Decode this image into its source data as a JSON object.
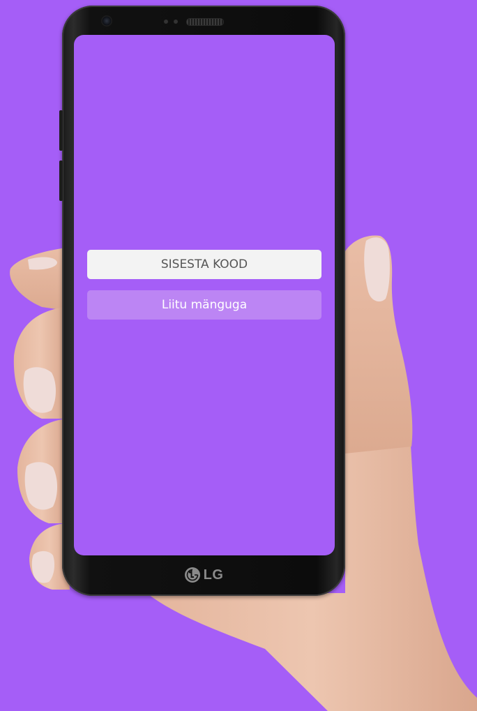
{
  "background_color": "#a55ef7",
  "device": {
    "brand": "LG",
    "logo_icon": "lg-logo-icon"
  },
  "join": {
    "code_placeholder": "SISESTA KOOD",
    "code_value": "",
    "button_label": "Liitu mänguga",
    "button_color": "#bc85f4",
    "input_color": "#f3f3f3"
  }
}
